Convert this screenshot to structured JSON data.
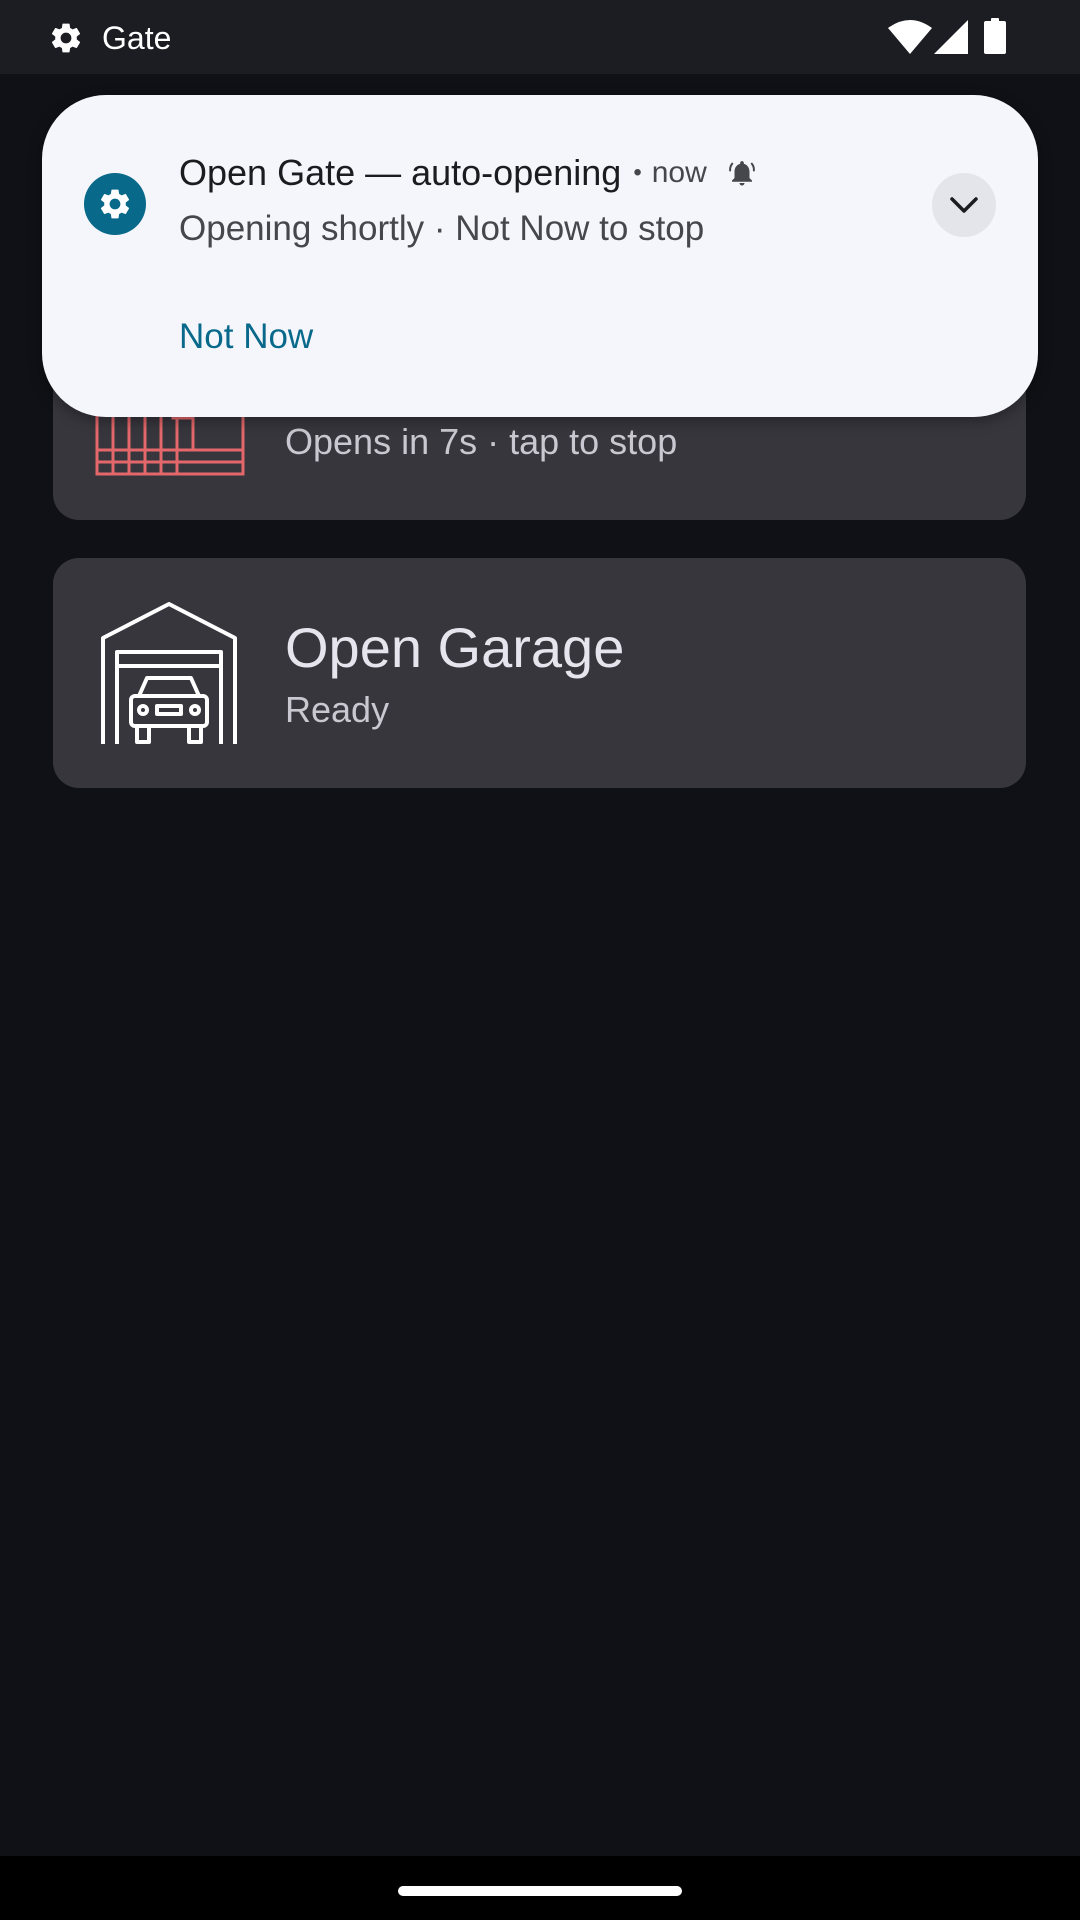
{
  "status_bar": {
    "app_label": "Gate",
    "icons": [
      "gear-icon",
      "wifi-icon",
      "cell-signal-icon",
      "battery-icon"
    ]
  },
  "devices": [
    {
      "name": "",
      "status": "Opens in 7s · tap to stop",
      "icon": "gate-icon",
      "icon_color": "#e4686b"
    },
    {
      "name": "Open Garage",
      "status": "Ready",
      "icon": "garage-icon",
      "icon_color": "#ffffff"
    }
  ],
  "notification": {
    "app_icon": "gear-icon",
    "title": "Open Gate — auto-opening",
    "separator": "•",
    "time": "now",
    "alert_icon": "bell-icon",
    "text": "Opening shortly · Not Now to stop",
    "action_label": "Not Now",
    "expand_icon": "chevron-down-icon",
    "accent_color": "#08698a"
  },
  "colors": {
    "background": "#0f1116",
    "card": "#37363d",
    "notification_bg": "#f4f6fb"
  }
}
